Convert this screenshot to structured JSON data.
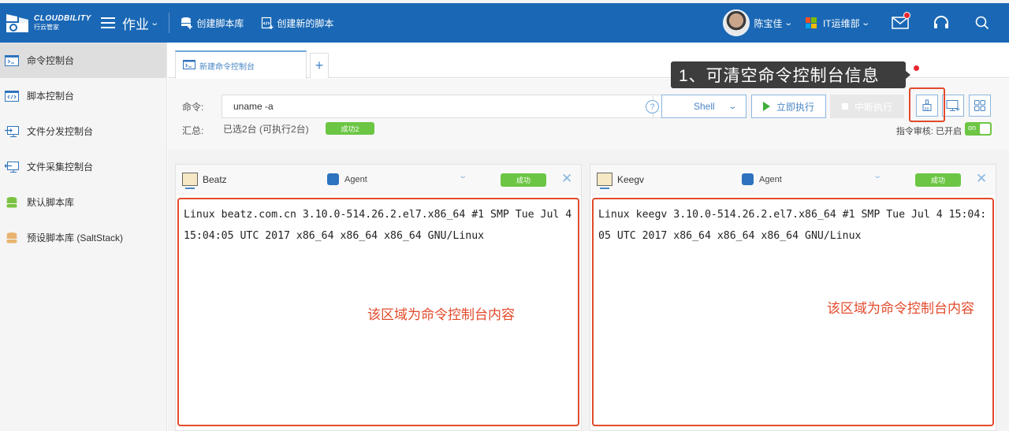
{
  "header": {
    "logo_en": "CLOUDBILITY",
    "logo_cn": "行云管家",
    "menu_label": "作业",
    "links": [
      {
        "label": "创建脚本库",
        "icon": "database-add-icon"
      },
      {
        "label": "创建新的脚本",
        "icon": "code-file-add-icon"
      }
    ],
    "user_name": "陈宝佳",
    "department": "IT运维部",
    "colors": {
      "header_bg": "#1a68b5",
      "notification_dot": "#e8272f"
    }
  },
  "sidebar": {
    "items": [
      {
        "label": "命令控制台",
        "icon": "terminal-icon",
        "active": true
      },
      {
        "label": "脚本控制台",
        "icon": "code-window-icon",
        "active": false
      },
      {
        "label": "文件分发控制台",
        "icon": "file-distribute-icon",
        "active": false
      },
      {
        "label": "文件采集控制台",
        "icon": "file-collect-icon",
        "active": false
      },
      {
        "label": "默认脚本库",
        "icon": "database-green-icon",
        "active": false
      },
      {
        "label": "预设脚本库 (SaltStack)",
        "icon": "database-orange-icon",
        "active": false
      }
    ]
  },
  "tabs": [
    {
      "label": "新建命令控制台",
      "active": true
    }
  ],
  "tab_add": "+",
  "command": {
    "label": "命令:",
    "value": "uname -a",
    "help": "?",
    "shell_type": "Shell",
    "run_label": "立即执行",
    "stop_label": "中断执行",
    "summary_label": "汇总:",
    "summary_value": "已选2台 (可执行2台)",
    "success_badge": "成功2",
    "audit_label": "指令审核: 已开启",
    "audit_toggle": "on"
  },
  "annotation": {
    "tooltip": "1、可清空命令控制台信息",
    "area_note": "该区域为命令控制台内容",
    "highlight_color": "#e24a2b"
  },
  "panels": [
    {
      "host": "Beatz",
      "agent": "Agent",
      "status": "成功",
      "output": "Linux beatz.com.cn 3.10.0-514.26.2.el7.x86_64 #1 SMP Tue Jul 4 15:04:05 UTC 2017 x86_64 x86_64 x86_64 GNU/Linux"
    },
    {
      "host": "Keegv",
      "agent": "Agent",
      "status": "成功",
      "output": "Linux keegv 3.10.0-514.26.2.el7.x86_64 #1 SMP Tue Jul 4 15:04:05 UTC 2017 x86_64 x86_64 x86_64 GNU/Linux"
    }
  ]
}
